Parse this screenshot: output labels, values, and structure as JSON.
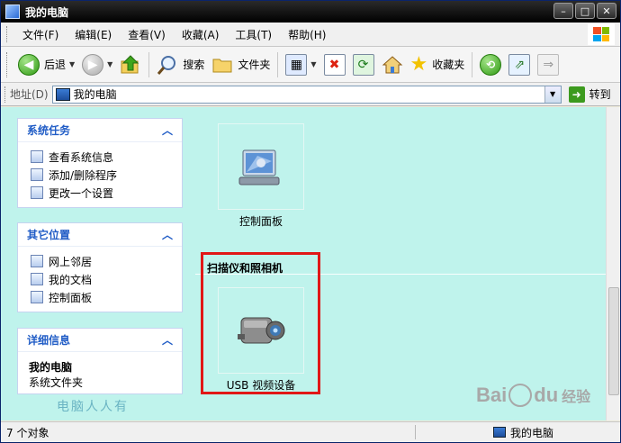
{
  "window": {
    "title": "我的电脑"
  },
  "menu": [
    "文件(F)",
    "编辑(E)",
    "查看(V)",
    "收藏(A)",
    "工具(T)",
    "帮助(H)"
  ],
  "toolbar": {
    "back": "后退",
    "search": "搜索",
    "folders": "文件夹",
    "favorites": "收藏夹"
  },
  "address": {
    "label": "地址(D)",
    "value": "我的电脑",
    "go": "转到"
  },
  "sidebar": {
    "system_tasks": {
      "title": "系统任务",
      "items": [
        "查看系统信息",
        "添加/删除程序",
        "更改一个设置"
      ]
    },
    "other_places": {
      "title": "其它位置",
      "items": [
        "网上邻居",
        "我的文档",
        "控制面板"
      ]
    },
    "details": {
      "title": "详细信息",
      "name": "我的电脑",
      "type": "系统文件夹"
    }
  },
  "main": {
    "items": [
      {
        "label": "控制面板",
        "icon": "control-panel-icon"
      },
      {
        "label": "USB 视频设备",
        "icon": "camera-icon"
      }
    ],
    "group_title": "扫描仪和照相机"
  },
  "watermarks": {
    "left_text": "电脑人人有",
    "baidu": "Bai",
    "baidu_du": "du",
    "jingyan": "经验"
  },
  "status": {
    "left": "7 个对象",
    "right": "我的电脑"
  },
  "colors": {
    "content_bg": "#bff3ec",
    "highlight": "#e11717",
    "panel_title": "#215dc6"
  }
}
